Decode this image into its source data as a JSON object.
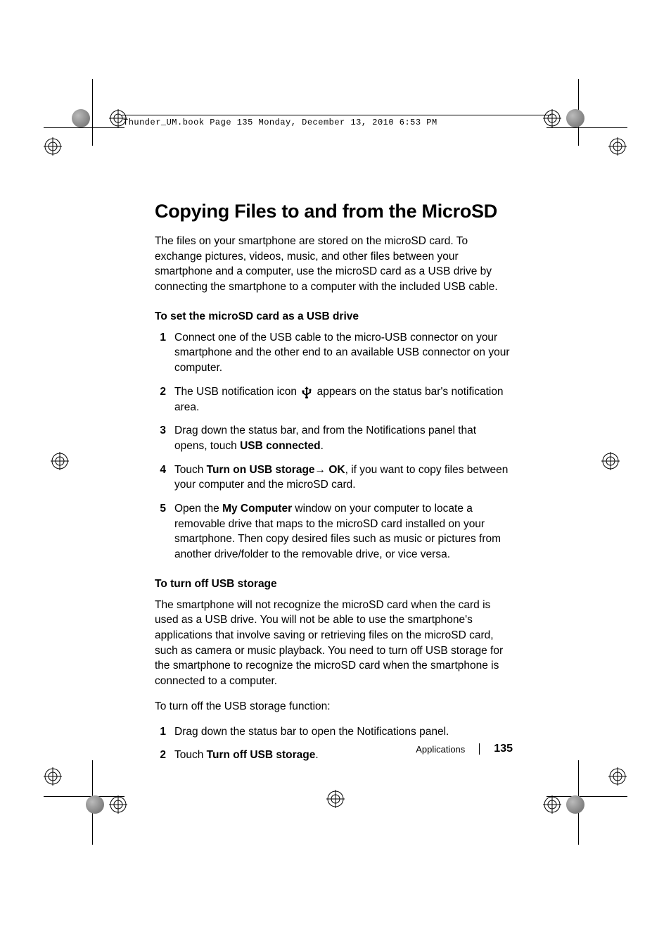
{
  "header_line": "Thunder_UM.book  Page 135  Monday, December 13, 2010  6:53 PM",
  "heading": "Copying Files to and from the MicroSD",
  "intro": "The files on your smartphone are stored on the microSD card. To exchange pictures, videos, music, and other files between your smartphone and a computer, use the microSD card as a USB drive by connecting the smartphone to a computer with the included USB cable.",
  "section1_title": "To set the microSD card as a USB drive",
  "steps1": [
    {
      "n": "1",
      "text": "Connect one of the USB cable to the micro-USB connector on your smartphone and the other end to an available USB connector on your computer."
    },
    {
      "n": "2",
      "pre": "The USB notification icon ",
      "post": " appears on the status bar's notification area."
    },
    {
      "n": "3",
      "pre": "Drag down the status bar, and from the Notifications panel that opens, touch ",
      "bold1": "USB connected",
      "post": "."
    },
    {
      "n": "4",
      "pre": "Touch ",
      "bold1": "Turn on USB storage",
      "arrow": "→ ",
      "bold2": "OK",
      "post": ", if you want to copy files between your computer and the microSD card."
    },
    {
      "n": "5",
      "pre": "Open the ",
      "bold1": "My Computer",
      "post": " window on your computer to locate a removable drive that maps to the microSD card installed on your smartphone. Then copy desired files such as music or pictures from another drive/folder to the removable drive, or vice versa."
    }
  ],
  "section2_title": "To turn off USB storage",
  "para2": "The smartphone will not recognize the microSD card when the card is used as a USB drive. You will not be able to use the smartphone's applications that involve saving or retrieving files on the microSD card, such as camera or music playback. You need to turn off USB storage for the smartphone to recognize the microSD card when the smartphone is connected to a computer.",
  "para3": "To turn off the USB storage function:",
  "steps2": [
    {
      "n": "1",
      "text": "Drag down the status bar to open the Notifications panel."
    },
    {
      "n": "2",
      "pre": "Touch ",
      "bold1": "Turn off USB storage",
      "post": "."
    }
  ],
  "footer_label": "Applications",
  "page_number": "135"
}
